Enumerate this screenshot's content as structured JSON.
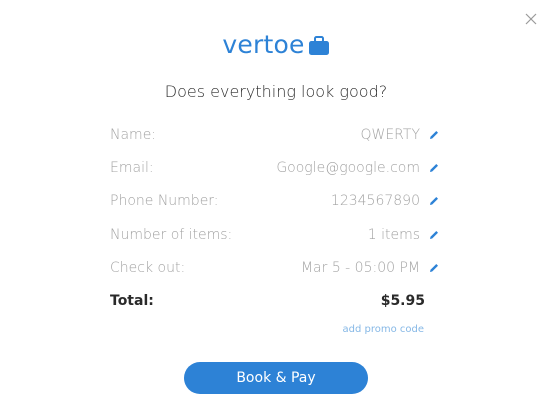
{
  "brand": {
    "name": "vertoe",
    "color": "#2d82d6"
  },
  "heading": "Does everything look good?",
  "icons": {
    "close": "close-icon",
    "edit": "pencil-icon",
    "logo": "briefcase-icon"
  },
  "details": [
    {
      "label": "Name:",
      "value": "QWERTY"
    },
    {
      "label": "Email:",
      "value": "Google@google.com"
    },
    {
      "label": "Phone Number:",
      "value": "1234567890"
    },
    {
      "label": "Number of items:",
      "value": "1 items"
    },
    {
      "label": "Check out:",
      "value": "Mar 5 - 05:00 PM"
    }
  ],
  "total": {
    "label": "Total:",
    "value": "$5.95"
  },
  "promo_link": "add promo code",
  "pay_button": "Book & Pay"
}
